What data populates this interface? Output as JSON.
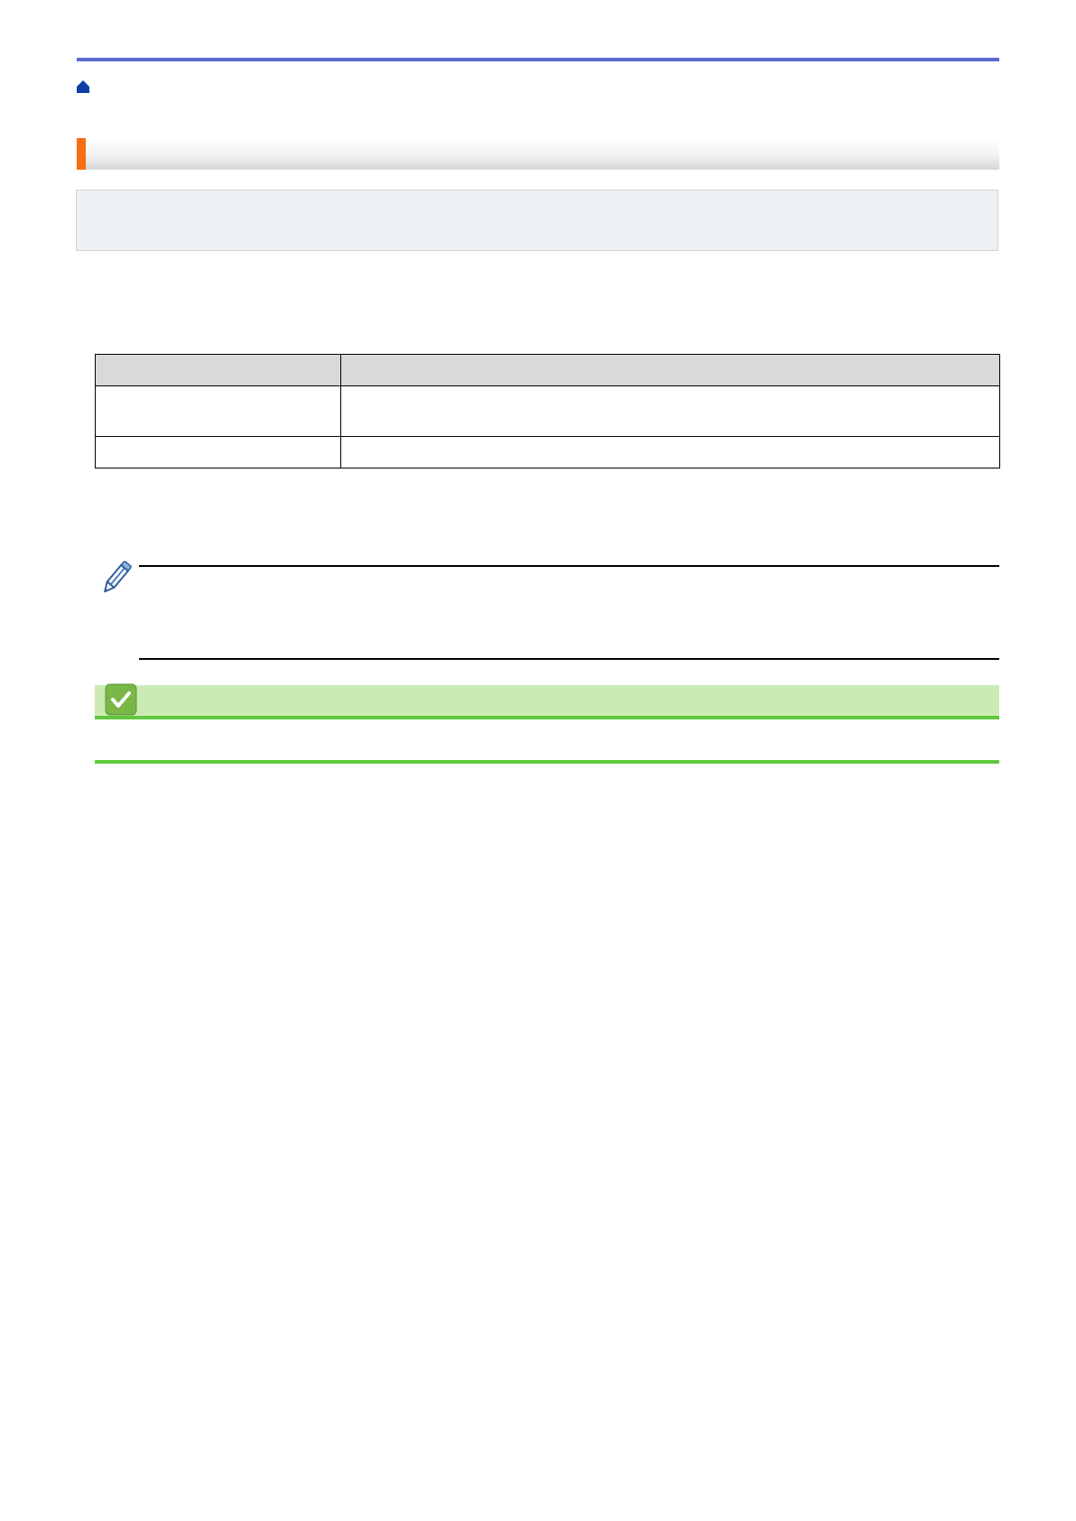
{
  "header": {
    "home_icon": "home-icon",
    "rule_color": "#5a6acf"
  },
  "title": {
    "accent_color": "#f76d12",
    "text": ""
  },
  "spec_table": {
    "headers": [
      "",
      ""
    ],
    "rows": [
      [
        "",
        ""
      ],
      [
        "",
        ""
      ]
    ]
  },
  "note": {
    "icon": "pencil-icon"
  },
  "related": {
    "icon": "checkmark-icon",
    "bar_color": "#cbebb5",
    "rule_color": "#5fc83c"
  }
}
